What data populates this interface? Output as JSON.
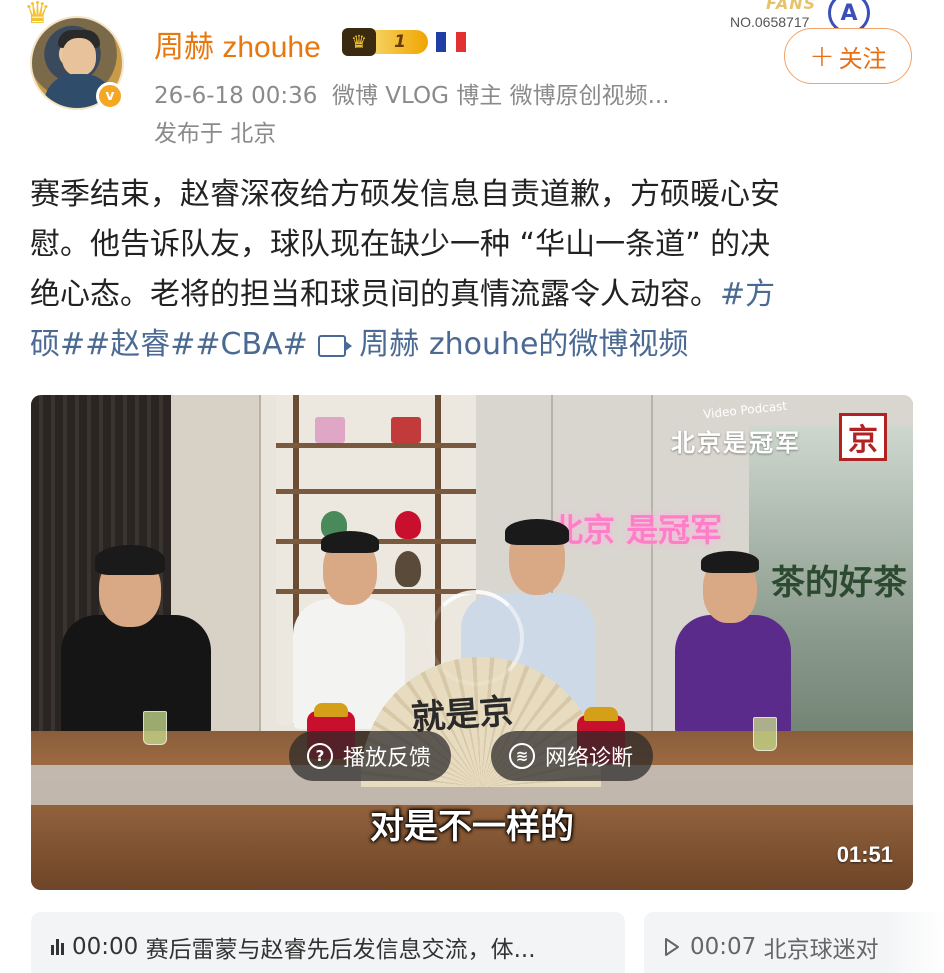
{
  "post": {
    "username": "周赫 zhouhe",
    "vip_level": "1",
    "timestamp": "26-6-18 00:36",
    "source": "微博 VLOG 博主 微博原创视频...",
    "location": "发布于 北京",
    "fans_label": "FANS",
    "fans_no": "NO.0658717",
    "fans_mark": "A",
    "follow_label": "关注",
    "text_line_1": "赛季结束，赵睿深夜给方硕发信息自责道歉，方硕暖心安",
    "text_line_2": "慰。他告诉队友，球队现在缺少一种 “华山一条道” 的决",
    "text_line_3a": "绝心态。老将的担当和球员间的真情流露令人动容。",
    "hashtag_fang_1": "#方",
    "hashtag_fang_2": "硕#",
    "hashtag_zhaorui": "#赵睿#",
    "hashtag_cba": "#CBA#",
    "video_link": "周赫 zhouhe的微博视频"
  },
  "video": {
    "podcast_sub": "Video Podcast",
    "podcast_title": "北京是冠军",
    "logo_char": "京",
    "neon_sign": "北京 是冠军",
    "poster_text": "茶的好茶",
    "fan_text": "就是京",
    "feedback_label": "播放反馈",
    "diagnose_label": "网络诊断",
    "subtitle": "对是不一样的",
    "duration": "01:51"
  },
  "chapters": [
    {
      "time": "00:00",
      "title": "赛后雷蒙与赵睿先后发信息交流，体..."
    },
    {
      "time": "00:07",
      "title": "北京球迷对"
    }
  ],
  "colors": {
    "username": "#e8770d",
    "link": "#4b6a93",
    "follow_border": "#f0a36a",
    "meta": "#8a8a8a"
  },
  "icons": [
    "crown-icon",
    "verified-icon",
    "vip-crown-icon",
    "france-flag-icon",
    "plus-icon",
    "video-link-icon",
    "question-circle-icon",
    "wifi-circle-icon",
    "audio-bars-icon",
    "play-icon"
  ]
}
